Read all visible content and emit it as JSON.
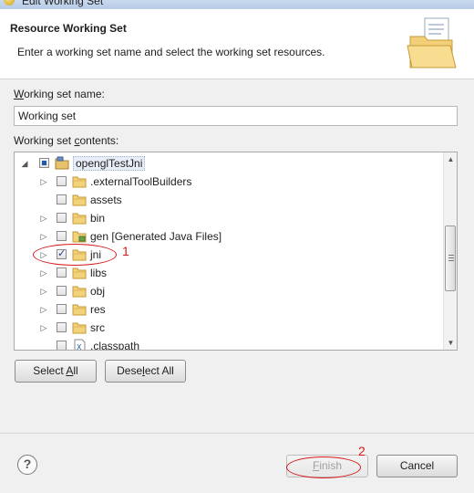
{
  "window": {
    "title": "Edit Working Set"
  },
  "header": {
    "title": "Resource Working Set",
    "description": "Enter a working set name and select the working set resources."
  },
  "form": {
    "name_label_first": "W",
    "name_label_rest": "orking set name:",
    "name_value": "Working set",
    "contents_label_a": "Working set ",
    "contents_label_u": "c",
    "contents_label_b": "ontents:"
  },
  "tree": {
    "root": {
      "label": "openglTestJni",
      "check_state": "partial",
      "expanded": true
    },
    "items": [
      {
        "label": ".externalToolBuilders",
        "icon": "folder-icon",
        "checked": false,
        "expandable": true
      },
      {
        "label": "assets",
        "icon": "folder-icon",
        "checked": false,
        "expandable": false
      },
      {
        "label": "bin",
        "icon": "folder-icon",
        "checked": false,
        "expandable": true
      },
      {
        "label": "gen [Generated Java Files]",
        "icon": "source-folder-icon",
        "checked": false,
        "expandable": true
      },
      {
        "label": "jni",
        "icon": "folder-icon",
        "checked": true,
        "expandable": true
      },
      {
        "label": "libs",
        "icon": "folder-icon",
        "checked": false,
        "expandable": true
      },
      {
        "label": "obj",
        "icon": "folder-icon",
        "checked": false,
        "expandable": true
      },
      {
        "label": "res",
        "icon": "folder-icon",
        "checked": false,
        "expandable": true
      },
      {
        "label": "src",
        "icon": "folder-icon",
        "checked": false,
        "expandable": true
      },
      {
        "label": ".classpath",
        "icon": "xml-file-icon",
        "checked": false,
        "expandable": false
      }
    ]
  },
  "buttons": {
    "select_all_a": "Select ",
    "select_all_u": "A",
    "select_all_b": "ll",
    "deselect_all_a": "Dese",
    "deselect_all_u": "l",
    "deselect_all_b": "ect All",
    "finish_u": "F",
    "finish_b": "inish",
    "cancel": "Cancel"
  },
  "annotations": {
    "first": "1",
    "second": "2"
  },
  "colors": {
    "annotation": "#d61a1a",
    "header_bg": "#ffffff",
    "dialog_bg": "#f0f0f0"
  }
}
